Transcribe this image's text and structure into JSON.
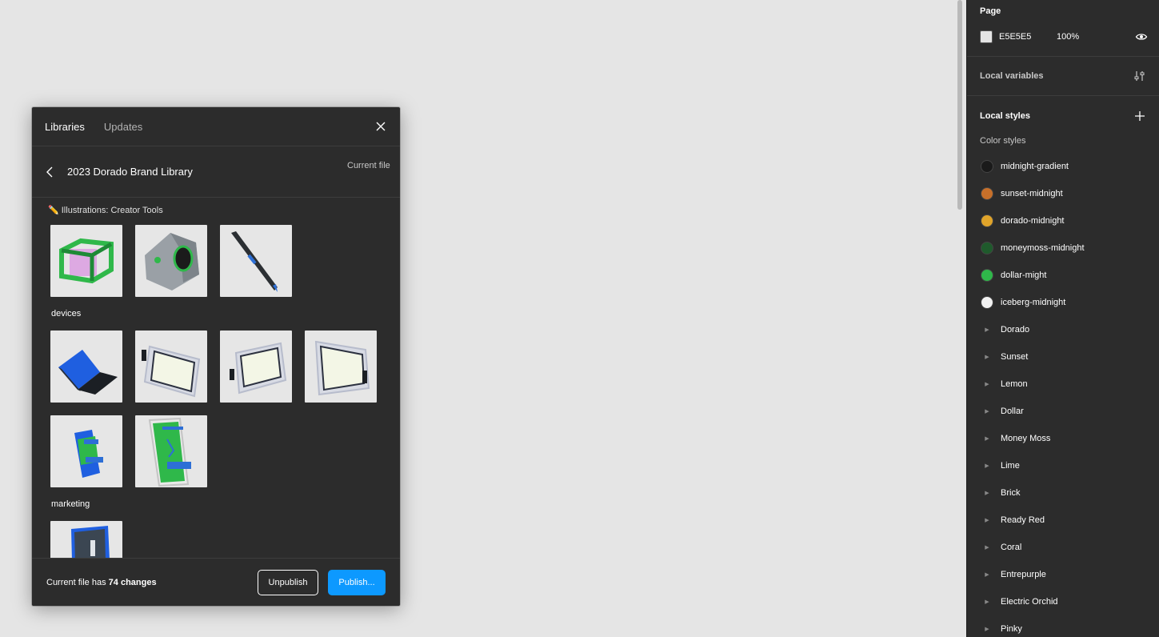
{
  "dialog": {
    "tabs": [
      {
        "label": "Libraries"
      },
      {
        "label": "Updates"
      }
    ],
    "library_name": "2023 Dorado Brand Library",
    "current_file_label": "Current file",
    "sections": {
      "creator_tools": "✏️ Illustrations: Creator Tools",
      "devices": "devices",
      "marketing": "marketing"
    },
    "footer": {
      "prefix": "Current file has ",
      "changes": "74 changes",
      "unpublish": "Unpublish",
      "publish": "Publish..."
    }
  },
  "right_panel": {
    "page": {
      "title": "Page",
      "color_hex": "E5E5E5",
      "opacity": "100%",
      "swatch_color": "#e5e5e5"
    },
    "local_variables": "Local variables",
    "local_styles": "Local styles",
    "color_styles_label": "Color styles",
    "color_styles": [
      {
        "label": "midnight-gradient",
        "color": "#1a1a1a"
      },
      {
        "label": "sunset-midnight",
        "color": "#c8702a"
      },
      {
        "label": "dorado-midnight",
        "color": "#e0a42a"
      },
      {
        "label": "moneymoss-midnight",
        "color": "#1f5a2c"
      },
      {
        "label": "dollar-might",
        "color": "#2fb84a"
      },
      {
        "label": "iceberg-midnight",
        "color": "#f2f2f2"
      }
    ],
    "style_groups": [
      {
        "label": "Dorado"
      },
      {
        "label": "Sunset"
      },
      {
        "label": "Lemon"
      },
      {
        "label": "Dollar"
      },
      {
        "label": "Money Moss"
      },
      {
        "label": "Lime"
      },
      {
        "label": "Brick"
      },
      {
        "label": "Ready Red"
      },
      {
        "label": "Coral"
      },
      {
        "label": "Entrepurple"
      },
      {
        "label": "Electric Orchid"
      },
      {
        "label": "Pinky"
      }
    ]
  }
}
